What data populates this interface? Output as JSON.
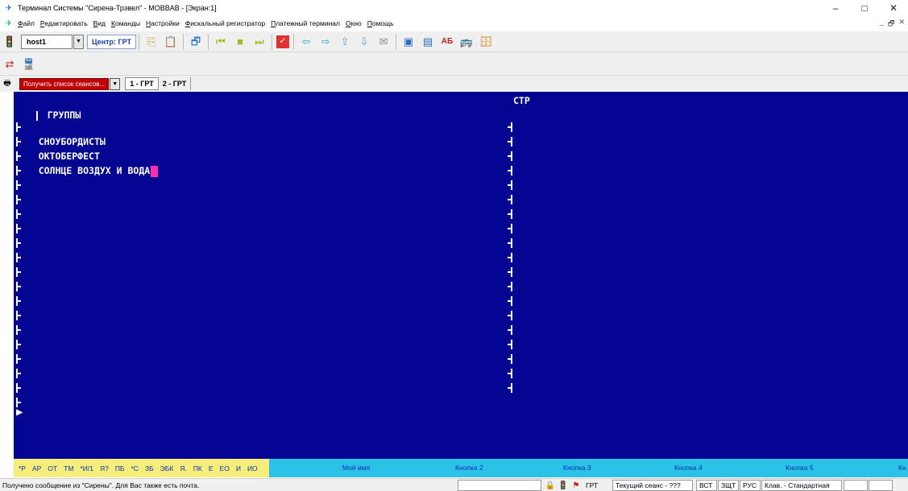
{
  "window": {
    "title": "Терминал Системы \"Сирена-Трэвел\" - MOBBAB - [Экран:1]",
    "controls": {
      "minimize": "–",
      "maximize": "□",
      "close": "✕"
    },
    "mdi_controls": {
      "minimize": "_",
      "restore": "🗗",
      "close": "✕"
    }
  },
  "menu": {
    "items": [
      "Файл",
      "Редактировать",
      "Вид",
      "Команды",
      "Настройки",
      "Фискальный регистратор",
      "Платежный терминал",
      "Окно",
      "Помощь"
    ]
  },
  "toolbar": {
    "host_value": "host1",
    "center_label": "Центр: ГРТ"
  },
  "session": {
    "get_sessions_label": "Получить список сеансов...",
    "tabs": [
      "1 - ГРТ",
      "2 - ГРТ"
    ]
  },
  "terminal": {
    "header_groups": "ГРУППЫ",
    "header_page": "СТР",
    "rows": [
      "СНОУБОРДИСТЫ",
      "ОКТОБЕРФЕСТ",
      "СОЛНЦЕ ВОЗДУХ И ВОДА"
    ],
    "colors": {
      "background": "#03048f",
      "text": "#ffffff",
      "cursor": "#ff2bb0"
    }
  },
  "function_keys": {
    "keywords": [
      "*Р",
      "АР",
      "ОТ",
      "ТМ",
      "*И/1",
      "Я?",
      "ПБ",
      "*С",
      "ЗБ",
      "ЭБК",
      "Я.",
      "ПК",
      "Е",
      "ЕО",
      "И",
      "ИО"
    ],
    "buttons": [
      "Моё имя",
      "Кнопка 2",
      "Кнопка 3",
      "Кнопка 4",
      "Кнопка 5",
      "Кн"
    ]
  },
  "status": {
    "message": "Получено сообщение из \"Сирены\". Для Вас также есть почта.",
    "grt": "ГРТ",
    "current_session": "Текущий сеанс - ???",
    "vst": "ВСТ",
    "zsht": "ЗЩТ",
    "rus": "РУС",
    "keyboard": "Клав. - Стандартная"
  }
}
